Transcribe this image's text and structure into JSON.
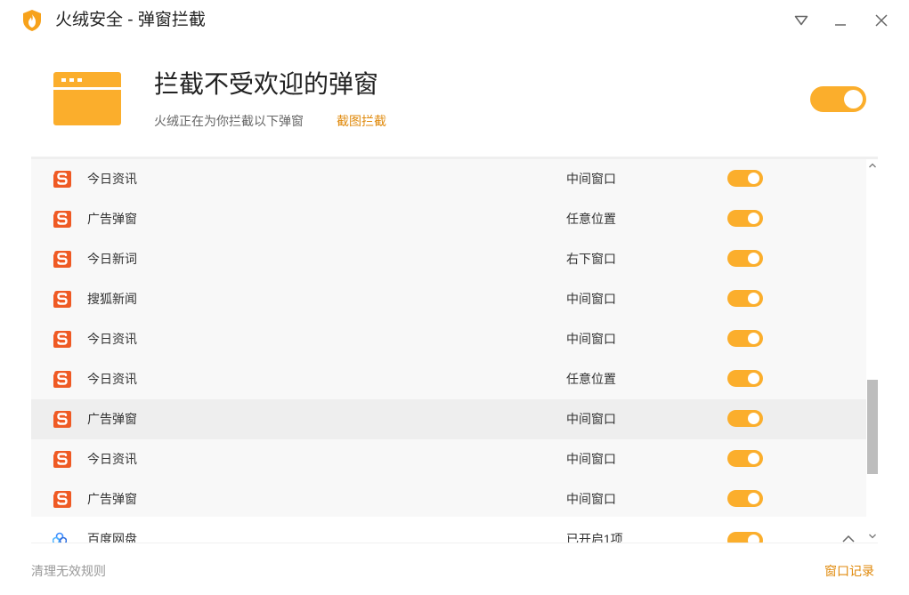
{
  "window": {
    "title": "火绒安全 - 弹窗拦截",
    "brand_color": "#fbae2c"
  },
  "header": {
    "title": "拦截不受欢迎的弹窗",
    "description": "火绒正在为你拦截以下弹窗",
    "screenshot_link": "截图拦截",
    "master_toggle_on": true
  },
  "rules": [
    {
      "name": "今日资讯",
      "position": "中间窗口",
      "enabled": true,
      "icon": "sogou-icon"
    },
    {
      "name": "广告弹窗",
      "position": "任意位置",
      "enabled": true,
      "icon": "sogou-icon"
    },
    {
      "name": "今日新词",
      "position": "右下窗口",
      "enabled": true,
      "icon": "sogou-icon"
    },
    {
      "name": "搜狐新闻",
      "position": "中间窗口",
      "enabled": true,
      "icon": "sogou-icon"
    },
    {
      "name": "今日资讯",
      "position": "中间窗口",
      "enabled": true,
      "icon": "sogou-icon"
    },
    {
      "name": "今日资讯",
      "position": "任意位置",
      "enabled": true,
      "icon": "sogou-icon"
    },
    {
      "name": "广告弹窗",
      "position": "中间窗口",
      "enabled": true,
      "icon": "sogou-icon",
      "highlighted": true
    },
    {
      "name": "今日资讯",
      "position": "中间窗口",
      "enabled": true,
      "icon": "sogou-icon"
    },
    {
      "name": "广告弹窗",
      "position": "中间窗口",
      "enabled": true,
      "icon": "sogou-icon"
    }
  ],
  "group": {
    "name": "百度网盘",
    "status": "已开启1项",
    "enabled": true,
    "icon": "baidu-netdisk-icon"
  },
  "footer": {
    "clean_rules": "清理无效规则",
    "window_log": "窗口记录"
  }
}
